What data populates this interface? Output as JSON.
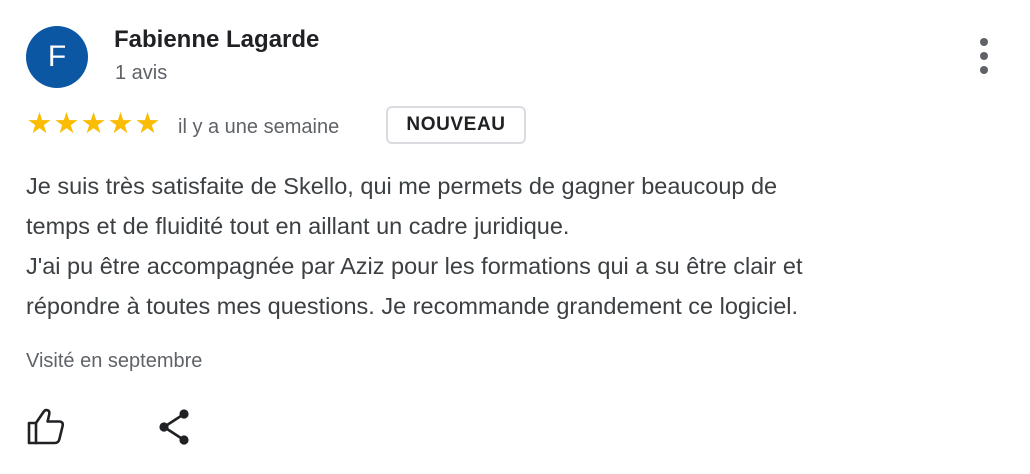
{
  "review": {
    "author": {
      "initial": "F",
      "name": "Fabienne Lagarde",
      "review_count": "1 avis",
      "avatar_color": "#0b57a4"
    },
    "rating": 5,
    "star_glyph": "★",
    "star_color": "#fbbc04",
    "date": "il y a une semaine",
    "badge": "NOUVEAU",
    "text_lines": [
      "Je suis très satisfaite de Skello, qui me permets de gagner beaucoup de",
      "temps et de fluidité tout en aillant un cadre juridique.",
      "J'ai pu être accompagnée par Aziz pour les formations qui a su être clair et",
      "répondre à toutes mes questions. Je recommande grandement ce logiciel."
    ],
    "visited": "Visité en septembre"
  },
  "actions": {
    "more_icon": "more-vertical-icon",
    "like_icon": "thumb-up-icon",
    "share_icon": "share-icon"
  }
}
